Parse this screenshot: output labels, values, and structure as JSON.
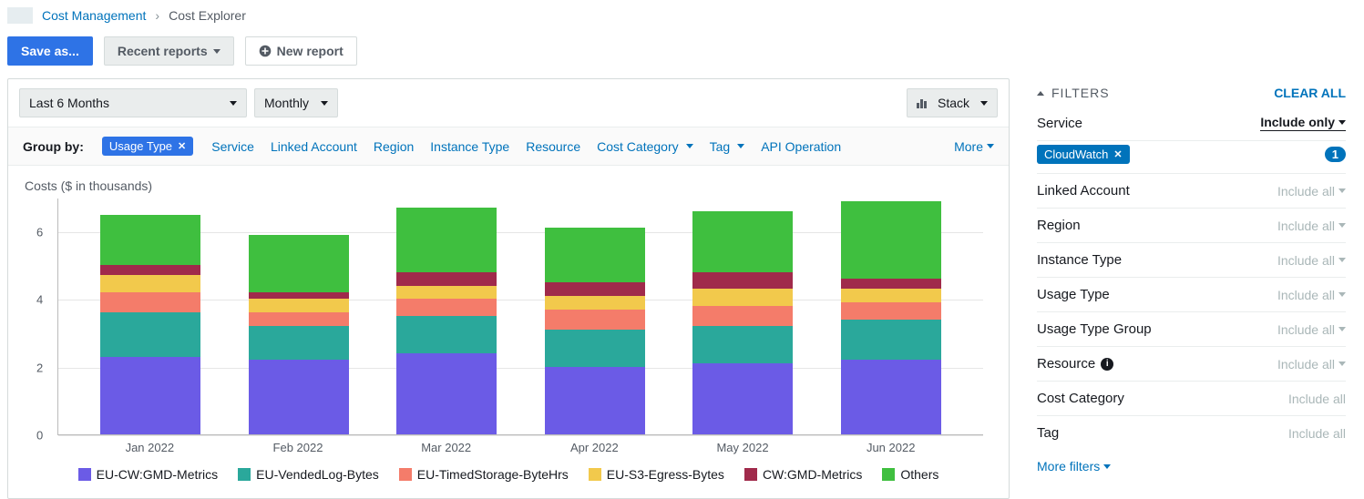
{
  "breadcrumb": {
    "parent": "Cost Management",
    "current": "Cost Explorer"
  },
  "actions": {
    "save": "Save as...",
    "recent": "Recent reports",
    "new": "New report"
  },
  "chart": {
    "range": "Last 6 Months",
    "granularity": "Monthly",
    "viewType": "Stack",
    "title": "Costs ($ in thousands)",
    "groupby_label": "Group by:",
    "groupby_tag": "Usage Type",
    "groupby_options": [
      "Service",
      "Linked Account",
      "Region",
      "Instance Type",
      "Resource",
      "Cost Category",
      "Tag",
      "API Operation"
    ],
    "groupby_more": "More"
  },
  "colors": {
    "purple": "#6b5be6",
    "teal": "#2aa89b",
    "salmon": "#f47c6a",
    "yellow": "#f2c94c",
    "maroon": "#a02a4b",
    "green": "#3fbf3f"
  },
  "chart_data": {
    "type": "bar",
    "stacked": true,
    "categories": [
      "Jan 2022",
      "Feb 2022",
      "Mar 2022",
      "Apr 2022",
      "May 2022",
      "Jun 2022"
    ],
    "series": [
      {
        "name": "EU-CW:GMD-Metrics",
        "color_key": "purple",
        "values": [
          2.3,
          2.2,
          2.4,
          2.0,
          2.1,
          2.2
        ]
      },
      {
        "name": "EU-VendedLog-Bytes",
        "color_key": "teal",
        "values": [
          1.3,
          1.0,
          1.1,
          1.1,
          1.1,
          1.2
        ]
      },
      {
        "name": "EU-TimedStorage-ByteHrs",
        "color_key": "salmon",
        "values": [
          0.6,
          0.4,
          0.5,
          0.6,
          0.6,
          0.5
        ]
      },
      {
        "name": "EU-S3-Egress-Bytes",
        "color_key": "yellow",
        "values": [
          0.5,
          0.4,
          0.4,
          0.4,
          0.5,
          0.4
        ]
      },
      {
        "name": "CW:GMD-Metrics",
        "color_key": "maroon",
        "values": [
          0.3,
          0.2,
          0.4,
          0.4,
          0.5,
          0.3
        ]
      },
      {
        "name": "Others",
        "color_key": "green",
        "values": [
          1.5,
          1.7,
          1.9,
          1.6,
          1.8,
          2.3
        ]
      }
    ],
    "ylabel": "",
    "xlabel": "",
    "ylim": [
      0,
      7
    ],
    "yticks": [
      0,
      2,
      4,
      6
    ]
  },
  "filters": {
    "title": "FILTERS",
    "clear": "CLEAR ALL",
    "more": "More filters",
    "rows": [
      {
        "name": "Service",
        "value": "Include only",
        "active": true,
        "tags": [
          {
            "label": "CloudWatch"
          }
        ],
        "count": 1
      },
      {
        "name": "Linked Account",
        "value": "Include all",
        "active": false
      },
      {
        "name": "Region",
        "value": "Include all",
        "active": false
      },
      {
        "name": "Instance Type",
        "value": "Include all",
        "active": false
      },
      {
        "name": "Usage Type",
        "value": "Include all",
        "active": false
      },
      {
        "name": "Usage Type Group",
        "value": "Include all",
        "active": false
      },
      {
        "name": "Resource",
        "value": "Include all",
        "active": false,
        "info": true
      },
      {
        "name": "Cost Category",
        "value": "Include all",
        "active": false,
        "nocaret": true
      },
      {
        "name": "Tag",
        "value": "Include all",
        "active": false,
        "nocaret": true
      }
    ]
  }
}
